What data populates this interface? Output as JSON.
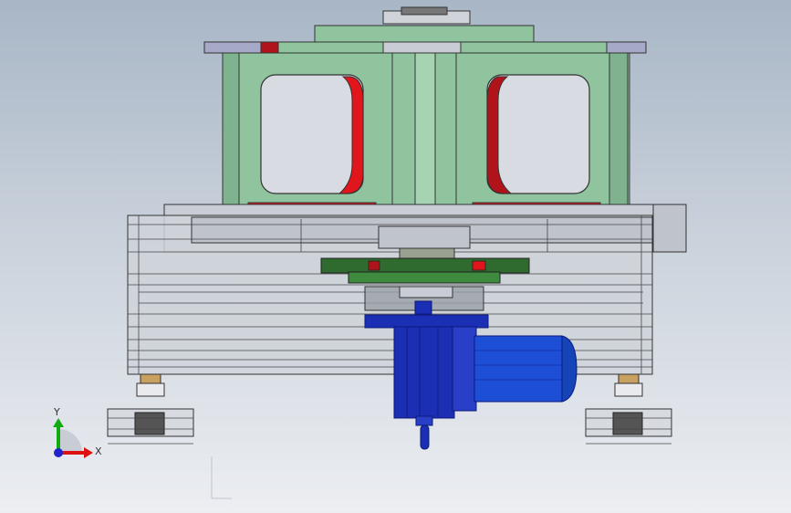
{
  "viewport": {
    "background_top": "#a8b6c6",
    "background_bottom": "#eceef2"
  },
  "colors": {
    "frame_green": "#8fc49f",
    "frame_green_dark": "#4f8a62",
    "highlight_red": "#e0161c",
    "gear_green": "#2f6b2f",
    "motor_blue": "#1b2fb5",
    "motor_blue_dark": "#0c1a7a",
    "housing_gray": "#c8ccd4",
    "line_dark": "#333333"
  },
  "triad": {
    "x_label": "X",
    "y_label": "Y",
    "x_color": "#d11",
    "y_color": "#1a1",
    "z_color": "#22c"
  }
}
